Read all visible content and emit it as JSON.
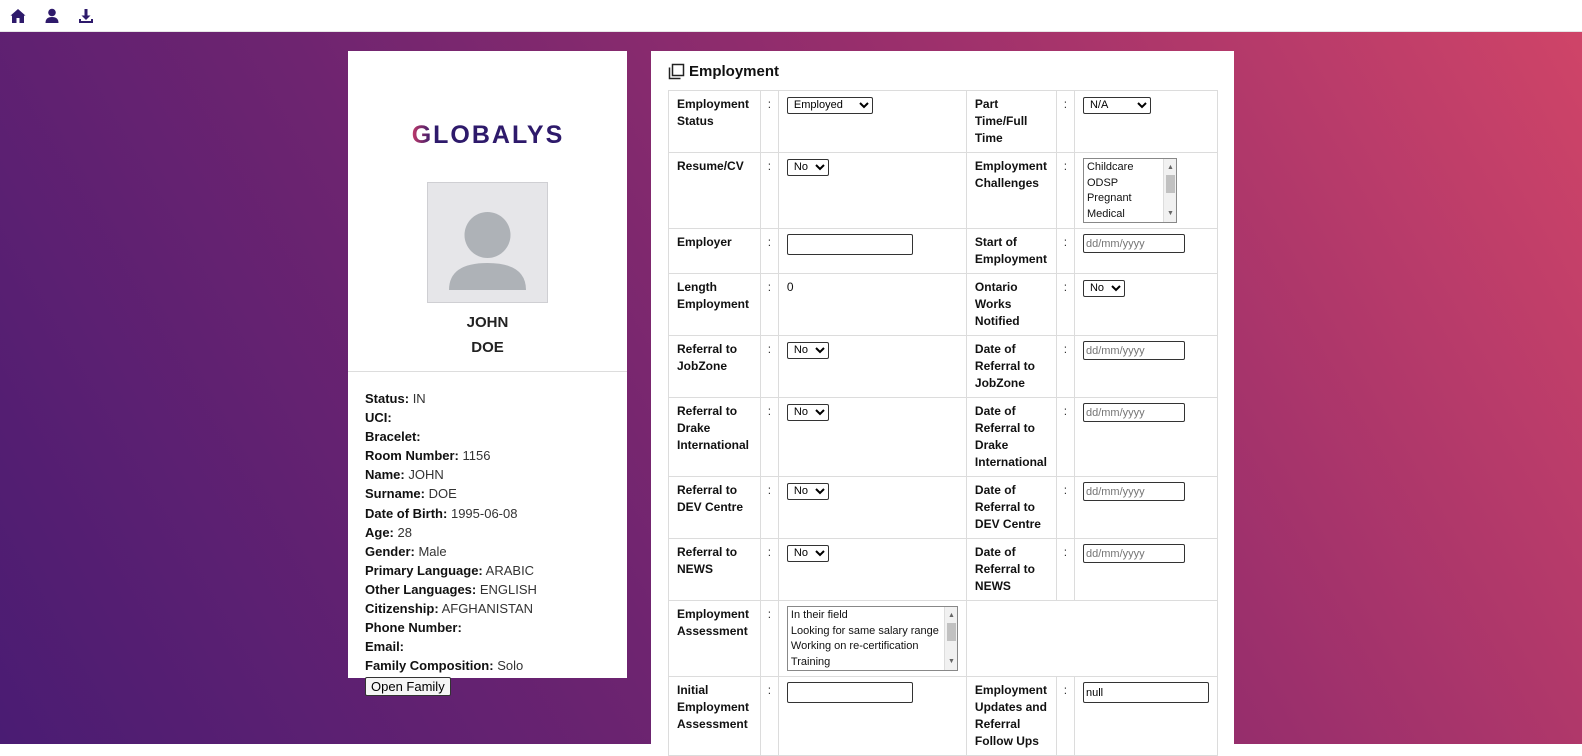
{
  "topbar": {
    "icons": [
      "home-icon",
      "user-icon",
      "download-icon"
    ]
  },
  "profile": {
    "logo_text": "GLOBALYS",
    "first_name": "JOHN",
    "last_name": "DOE",
    "fields": [
      {
        "label": "Status:",
        "value": "IN"
      },
      {
        "label": "UCI:",
        "value": ""
      },
      {
        "label": "Bracelet:",
        "value": ""
      },
      {
        "label": "Room Number:",
        "value": "1156"
      },
      {
        "label": "Name:",
        "value": "JOHN"
      },
      {
        "label": "Surname:",
        "value": "DOE"
      },
      {
        "label": "Date of Birth:",
        "value": "1995-06-08"
      },
      {
        "label": "Age:",
        "value": "28"
      },
      {
        "label": "Gender:",
        "value": "Male"
      },
      {
        "label": "Primary Language:",
        "value": "ARABIC"
      },
      {
        "label": "Other Languages:",
        "value": "ENGLISH"
      },
      {
        "label": "Citizenship:",
        "value": "AFGHANISTAN"
      },
      {
        "label": "Phone Number:",
        "value": ""
      },
      {
        "label": "Email:",
        "value": ""
      },
      {
        "label": "Family Composition:",
        "value": "Solo"
      }
    ],
    "open_family_label": "Open Family"
  },
  "employment": {
    "title": "Employment",
    "colon": ":",
    "employment_status": {
      "label": "Employment Status",
      "value": "Employed"
    },
    "part_time": {
      "label": "Part Time/Full Time",
      "value": "N/A"
    },
    "resume": {
      "label": "Resume/CV",
      "value": "No"
    },
    "challenges": {
      "label": "Employment Challenges",
      "options": [
        "Childcare",
        "ODSP",
        "Pregnant",
        "Medical"
      ]
    },
    "employer": {
      "label": "Employer",
      "value": ""
    },
    "start": {
      "label": "Start of Employment",
      "placeholder": "dd/mm/yyyy"
    },
    "length": {
      "label": "Length Employment",
      "value": "0"
    },
    "ontario": {
      "label": "Ontario Works Notified",
      "value": "No"
    },
    "jobzone": {
      "label": "Referral to JobZone",
      "value": "No"
    },
    "jobzone_date": {
      "label": "Date of Referral to JobZone",
      "placeholder": "dd/mm/yyyy"
    },
    "drake": {
      "label": "Referral to Drake International",
      "value": "No"
    },
    "drake_date": {
      "label": "Date of Referral to Drake International",
      "placeholder": "dd/mm/yyyy"
    },
    "dev": {
      "label": "Referral to DEV Centre",
      "value": "No"
    },
    "dev_date": {
      "label": "Date of Referral to DEV Centre",
      "placeholder": "dd/mm/yyyy"
    },
    "news": {
      "label": "Referral to NEWS",
      "value": "No"
    },
    "news_date": {
      "label": "Date of Referral to NEWS",
      "placeholder": "dd/mm/yyyy"
    },
    "assessment": {
      "label": "Employment Assessment",
      "options": [
        "In their field",
        "Looking for same salary range",
        "Working on re-certification",
        "Training"
      ]
    },
    "initial": {
      "label": "Initial Employment Assessment",
      "value": ""
    },
    "updates": {
      "label": "Employment Updates and Referral Follow Ups",
      "value": "null"
    }
  },
  "colors": {
    "bg_start": "#4a1c73",
    "bg_end": "#cf4468",
    "logo": "#2e1a6b"
  }
}
